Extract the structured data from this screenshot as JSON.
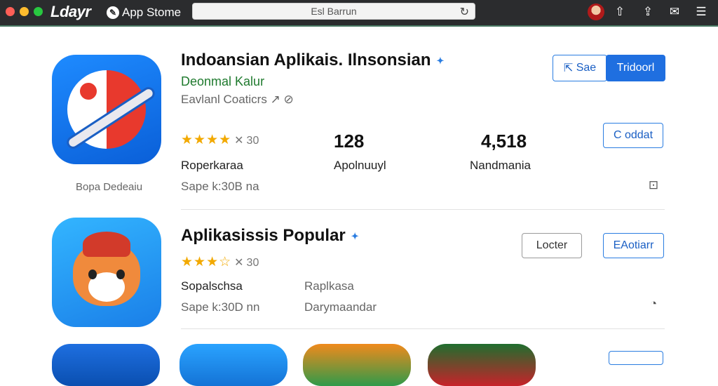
{
  "topbar": {
    "brand": "Ldayr",
    "store_label": "App Stome",
    "search_value": "Esl Barrun",
    "colors": {
      "close": "#ff5f57",
      "minimize": "#febc2e",
      "zoom": "#28c840"
    }
  },
  "apps": [
    {
      "title": "Indoansian Aplikais. Ilnsonsian",
      "developer": "Deonmal Kalur",
      "subtitle": "Eavlanl Coaticrs",
      "rating_count": "30",
      "rating_stars": 4,
      "stat_label_1": "Roperkaraa",
      "stat_value_2": "128",
      "stat_label_2": "Apolnuuyl",
      "stat_value_3": "4,518",
      "stat_label_3": "Nandmania",
      "size_info": "Sape k:30B  na",
      "icon_caption": "Bopa Dedeaiu",
      "btn_sae": "Sae",
      "btn_tridoorl": "Tridoorl",
      "btn_cadat": "C oddat"
    },
    {
      "title": "Aplikasissis Popular",
      "rating_count": "30",
      "rating_stars": 3.5,
      "label_left_1": "Sopalschsa",
      "label_right_1": "Raplkasa",
      "label_left_2": "Sape k:30D  nn",
      "label_right_2": "Darymaandar",
      "btn_locter": "Locter",
      "btn_aotiarr": "EAotiarr"
    }
  ],
  "icons": {
    "apps_bar": "pencil-icon",
    "share": "share-icon",
    "export": "export-icon",
    "chat": "chat-icon",
    "more": "menu-icon",
    "refresh": "refresh-icon",
    "verified": "verified-icon",
    "save": "save-icon",
    "compass": "compass-icon"
  },
  "accent": "#1f6fe0"
}
